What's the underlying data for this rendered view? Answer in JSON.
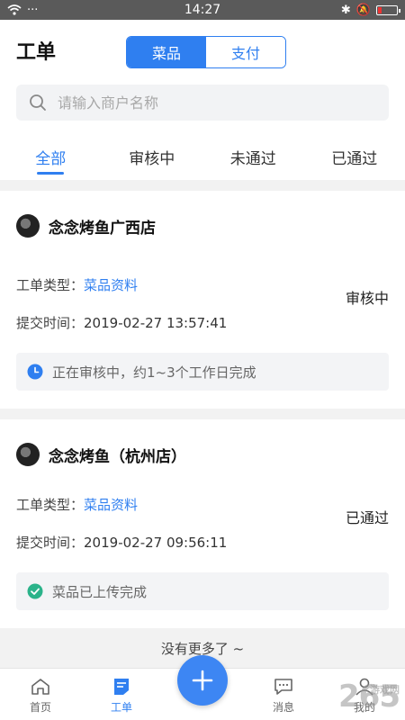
{
  "status_bar": {
    "time": "14:27"
  },
  "header": {
    "title": "工单",
    "segments": [
      "菜品",
      "支付"
    ],
    "active_segment": 0
  },
  "search": {
    "placeholder": "请输入商户名称",
    "value": ""
  },
  "tabs": [
    "全部",
    "审核中",
    "未通过",
    "已通过"
  ],
  "active_tab": 0,
  "orders": [
    {
      "store": "念念烤鱼广西店",
      "type_label": "工单类型：",
      "type_value": "菜品资料",
      "time_label": "提交时间：",
      "time_value": "2019-02-27 13:57:41",
      "status": "审核中",
      "notice": "正在审核中，约1~3个工作日完成",
      "notice_icon": "clock-icon",
      "notice_color": "#2f7ff0"
    },
    {
      "store": "念念烤鱼（杭州店）",
      "type_label": "工单类型：",
      "type_value": "菜品资料",
      "time_label": "提交时间：",
      "time_value": "2019-02-27 09:56:11",
      "status": "已通过",
      "notice": "菜品已上传完成",
      "notice_icon": "check-circle-icon",
      "notice_color": "#2bb38a"
    }
  ],
  "no_more": "没有更多了 ~",
  "bottom_nav": {
    "home": "首页",
    "orders": "工单",
    "messages": "消息",
    "mine": "我的"
  },
  "watermark": {
    "text": "265",
    "sub": "游戏网"
  },
  "colors": {
    "accent": "#2f7ff0",
    "success": "#2bb38a"
  }
}
